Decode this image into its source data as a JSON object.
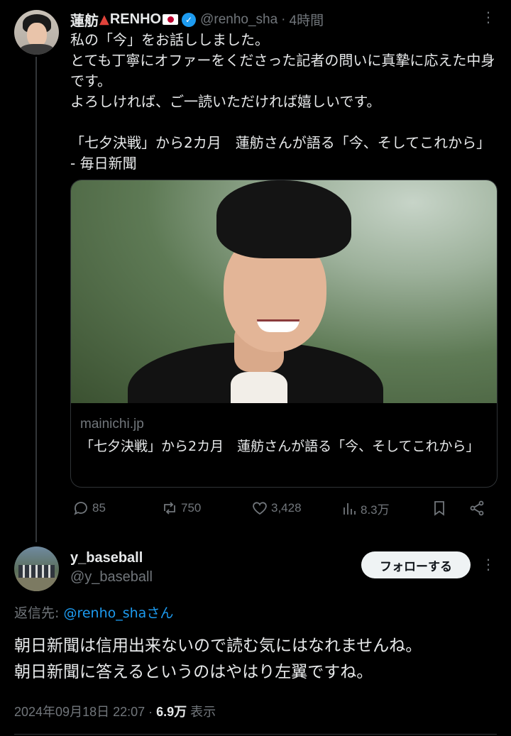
{
  "main_tweet": {
    "author_name": "蓮舫",
    "author_name_suffix": "RENHO",
    "handle": "@renho_sha",
    "separator": "·",
    "time": "4時間",
    "text": "私の「今」をお話ししました。\nとても丁寧にオファーをくださった記者の問いに真摯に応えた中身です。\nよろしければ、ご一読いただければ嬉しいです。\n\n「七夕決戦」から2カ月　蓮舫さんが語る「今、そしてこれから」 - 毎日新聞",
    "card": {
      "domain": "mainichi.jp",
      "title": "「七夕決戦」から2カ月　蓮舫さんが語る「今、そしてこれから」"
    },
    "actions": {
      "replies": "85",
      "reposts": "750",
      "likes": "3,428",
      "views": "8.3万"
    }
  },
  "reply_tweet": {
    "author_name": "y_baseball",
    "handle": "@y_baseball",
    "follow_label": "フォローする",
    "reply_to_prefix": "返信先: ",
    "reply_to_mention": "@renho_shaさん",
    "text": "朝日新聞は信用出来ないので読む気にはなれませんね。\n朝日新聞に答えるというのはやはり左翼ですね。",
    "timestamp": "2024年09月18日 22:07",
    "dot": " · ",
    "views_count": "6.9万",
    "views_label": " 表示"
  },
  "icons": {
    "more": "more-dots-icon",
    "verified": "verified-badge-icon",
    "reply": "reply-icon",
    "repost": "repost-icon",
    "like": "heart-icon",
    "views": "analytics-icon",
    "bookmark": "bookmark-icon",
    "share": "share-icon"
  },
  "colors": {
    "background": "#000000",
    "text_primary": "#e7e9ea",
    "text_secondary": "#71767b",
    "accent": "#1d9bf0",
    "border": "#2f3336"
  }
}
